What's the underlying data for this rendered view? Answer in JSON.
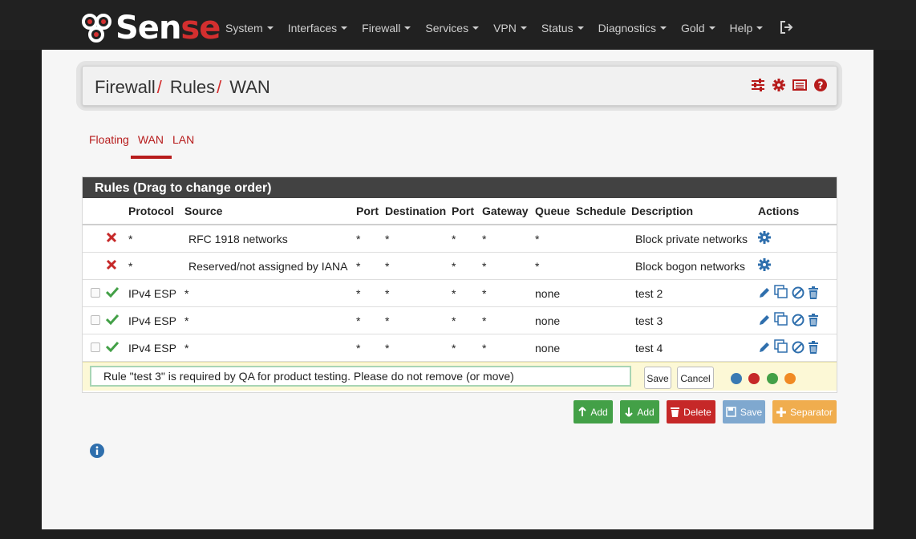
{
  "brand": {
    "prefix": "pf",
    "text_main": "Sen",
    "text_accent": "se"
  },
  "nav": {
    "items": [
      "System",
      "Interfaces",
      "Firewall",
      "Services",
      "VPN",
      "Status",
      "Diagnostics",
      "Gold",
      "Help"
    ]
  },
  "breadcrumb": {
    "parts": [
      "Firewall",
      "Rules",
      "WAN"
    ],
    "separator": "/"
  },
  "tabs": {
    "items": [
      "Floating",
      "WAN",
      "LAN"
    ],
    "active": "WAN"
  },
  "panel": {
    "title": "Rules (Drag to change order)",
    "columns": [
      "",
      "",
      "Protocol",
      "Source",
      "Port",
      "Destination",
      "Port",
      "Gateway",
      "Queue",
      "Schedule",
      "Description",
      "Actions"
    ],
    "rows": [
      {
        "selectable": false,
        "status": "blocked",
        "protocol": "*",
        "source": "RFC 1918 networks",
        "src_port": "*",
        "destination": "*",
        "dst_port": "*",
        "gateway": "*",
        "queue": "*",
        "schedule": "",
        "description": "Block private networks",
        "actions": "settings"
      },
      {
        "selectable": false,
        "status": "blocked",
        "protocol": "*",
        "source": "Reserved/not assigned by IANA",
        "src_port": "*",
        "destination": "*",
        "dst_port": "*",
        "gateway": "*",
        "queue": "*",
        "schedule": "",
        "description": "Block bogon networks",
        "actions": "settings"
      },
      {
        "selectable": true,
        "status": "pass",
        "protocol": "IPv4 ESP",
        "source": "*",
        "src_port": "*",
        "destination": "*",
        "dst_port": "*",
        "gateway": "*",
        "queue": "none",
        "schedule": "",
        "description": "test 2",
        "actions": "full"
      },
      {
        "selectable": true,
        "status": "pass",
        "protocol": "IPv4 ESP",
        "source": "*",
        "src_port": "*",
        "destination": "*",
        "dst_port": "*",
        "gateway": "*",
        "queue": "none",
        "schedule": "",
        "description": "test 3",
        "actions": "full"
      },
      {
        "selectable": true,
        "status": "pass",
        "protocol": "IPv4 ESP",
        "source": "*",
        "src_port": "*",
        "destination": "*",
        "dst_port": "*",
        "gateway": "*",
        "queue": "none",
        "schedule": "",
        "description": "test 4",
        "actions": "full"
      }
    ],
    "separator": {
      "value": "Rule \"test 3\" is required by QA for product testing. Please do not remove (or move)",
      "save_label": "Save",
      "cancel_label": "Cancel",
      "colors": [
        "#3a7ab3",
        "#c62828",
        "#43a047",
        "#f08a24"
      ]
    }
  },
  "buttons": {
    "add_top": "Add",
    "add_bottom": "Add",
    "delete": "Delete",
    "save": "Save",
    "separator": "Separator"
  },
  "colors": {
    "accent": "#b71c1c",
    "success": "#43a047",
    "primary": "#3a7ab3",
    "warning": "#f0ad4e",
    "info": "#7fa8cf"
  }
}
